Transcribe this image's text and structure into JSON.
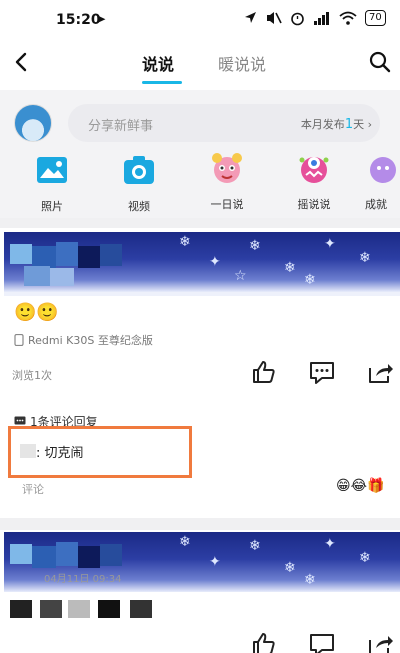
{
  "status_bar": {
    "time": "15:20",
    "nav_arrow": "➤",
    "battery": "70"
  },
  "nav": {
    "tabs": [
      {
        "label": "说说",
        "active": true
      },
      {
        "label": "暖说说",
        "active": false
      }
    ]
  },
  "composer": {
    "placeholder": "分享新鲜事",
    "monthly_prefix": "本月发布",
    "monthly_count": "1",
    "monthly_suffix": "天",
    "monthly_arrow": "›"
  },
  "shortcuts": [
    {
      "label": "照片",
      "icon": "photo-icon"
    },
    {
      "label": "视频",
      "icon": "camera-icon"
    },
    {
      "label": "一日说",
      "icon": "daily-talk-icon"
    },
    {
      "label": "摇说说",
      "icon": "shake-icon"
    },
    {
      "label": "成就",
      "icon": "achievement-icon"
    }
  ],
  "post": {
    "emoji": "🙂🙂",
    "device": "Redmi K30S 至尊纪念版",
    "views": "浏览1次",
    "comment_header": "1条评论回复",
    "comment_author_suffix": ":",
    "comment_text": "切克闹",
    "comment_placeholder": "评论",
    "reactions": "😁😂🎁"
  },
  "post2": {
    "date": "04月11日 09:34"
  },
  "colors": {
    "accent": "#19b7e6",
    "highlight": "#f07a3e"
  }
}
